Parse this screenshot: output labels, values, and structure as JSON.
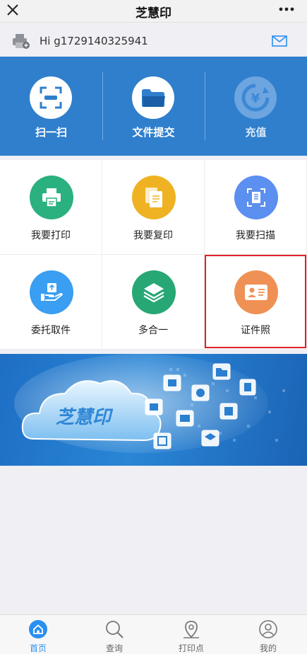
{
  "header": {
    "title": "芝慧印",
    "close_icon": "close-icon",
    "more_icon": "more-icon"
  },
  "greeting": {
    "text": "Hi g1729140325941",
    "avatar_icon": "printer-avatar-icon",
    "mail_icon": "mail-icon"
  },
  "quick_actions": [
    {
      "label": "扫一扫",
      "icon": "scan-icon"
    },
    {
      "label": "文件提交",
      "icon": "folder-icon"
    },
    {
      "label": "充值",
      "icon": "yuan-refresh-icon"
    }
  ],
  "services": [
    {
      "label": "我要打印",
      "icon": "printer-icon",
      "color": "#2bb07f"
    },
    {
      "label": "我要复印",
      "icon": "copy-icon",
      "color": "#efb223"
    },
    {
      "label": "我要扫描",
      "icon": "scan-document-icon",
      "color": "#5b8ff0"
    },
    {
      "label": "委托取件",
      "icon": "hand-package-icon",
      "color": "#3a9ef2"
    },
    {
      "label": "多合一",
      "icon": "layers-icon",
      "color": "#27a774"
    },
    {
      "label": "证件照",
      "icon": "id-card-icon",
      "color": "#ef9154"
    }
  ],
  "promo_banner": {
    "logo_text": "芝慧印"
  },
  "tabbar": [
    {
      "label": "首页",
      "icon": "home-icon",
      "active": true
    },
    {
      "label": "查询",
      "icon": "search-icon",
      "active": false
    },
    {
      "label": "打印点",
      "icon": "location-icon",
      "active": false
    },
    {
      "label": "我的",
      "icon": "user-icon",
      "active": false
    }
  ],
  "colors": {
    "accent": "#2a8ff0",
    "banner": "#2f7fcd",
    "highlight": "#e0202a"
  }
}
